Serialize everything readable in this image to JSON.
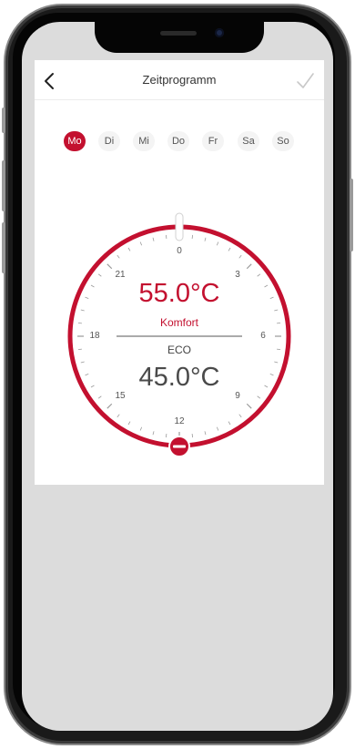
{
  "header": {
    "title": "Zeitprogramm",
    "back_icon": "chevron-left-icon",
    "confirm_icon": "checkmark-icon"
  },
  "days": [
    {
      "label": "Mo",
      "active": true
    },
    {
      "label": "Di",
      "active": false
    },
    {
      "label": "Mi",
      "active": false
    },
    {
      "label": "Do",
      "active": false
    },
    {
      "label": "Fr",
      "active": false
    },
    {
      "label": "Sa",
      "active": false
    },
    {
      "label": "So",
      "active": false
    }
  ],
  "dial": {
    "hour_labels": {
      "h0": "0",
      "h3": "3",
      "h6": "6",
      "h9": "9",
      "h12": "12",
      "h15": "15",
      "h18": "18",
      "h21": "21"
    },
    "comfort": {
      "temperature": "55.0°C",
      "mode": "Komfort"
    },
    "eco": {
      "temperature": "45.0°C",
      "mode": "ECO"
    },
    "accent_color": "#c3102f",
    "start_handle_icon": "slider-handle-icon",
    "end_handle_icon": "minus-handle-icon"
  }
}
